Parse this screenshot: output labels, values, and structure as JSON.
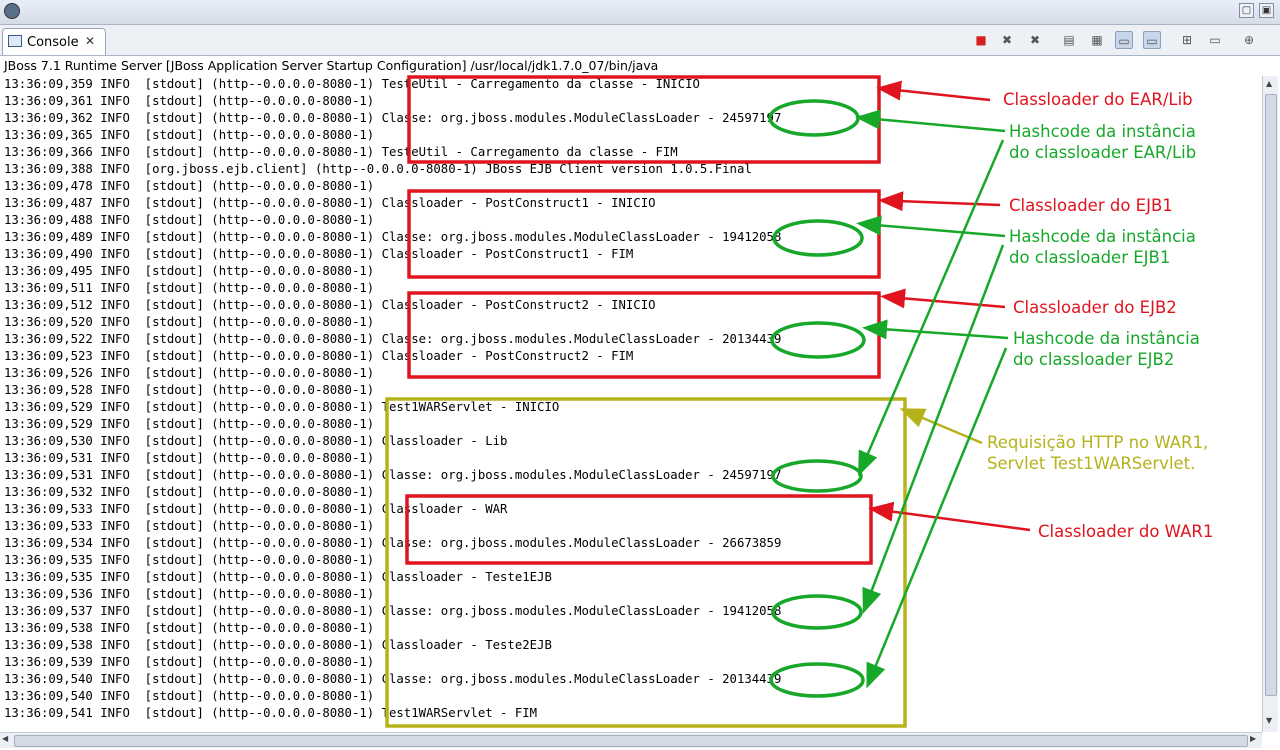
{
  "colors": {
    "red": "#e0141e",
    "green": "#17a82a",
    "olive": "#b5b21a"
  },
  "tab": {
    "label": "Console",
    "icon": "console-icon",
    "close_icon": "close-icon"
  },
  "window": {
    "minimize_icon": "minimize-icon",
    "maximize_icon": "maximize-icon"
  },
  "toolbar_icons": [
    "terminate-icon",
    "remove-launch-icon",
    "remove-all-icon",
    "clear-console-icon",
    "scroll-lock-icon",
    "show-stdout-icon",
    "show-stderr-icon",
    "pin-console-icon",
    "display-console-icon",
    "open-console-icon"
  ],
  "console": {
    "header": "JBoss 7.1 Runtime Server [JBoss Application Server Startup Configuration] /usr/local/jdk1.7.0_07/bin/java",
    "lines": [
      {
        "p": "13:36:09,359 INFO  [stdout] (http--0.0.0.0-8080-1)",
        "m": "TesteUtil - Carregamento da classe - INICIO"
      },
      {
        "p": "13:36:09,361 INFO  [stdout] (http--0.0.0.0-8080-1)",
        "m": ""
      },
      {
        "p": "13:36:09,362 INFO  [stdout] (http--0.0.0.0-8080-1)",
        "m": "Classe: org.jboss.modules.ModuleClassLoader - 24597197"
      },
      {
        "p": "13:36:09,365 INFO  [stdout] (http--0.0.0.0-8080-1)",
        "m": ""
      },
      {
        "p": "13:36:09,366 INFO  [stdout] (http--0.0.0.0-8080-1)",
        "m": "TesteUtil - Carregamento da classe - FIM"
      },
      {
        "p": "13:36:09,388 INFO  [org.jboss.ejb.client] (http--0.0.0.0-8080-1)",
        "m": "JBoss EJB Client version 1.0.5.Final"
      },
      {
        "p": "13:36:09,478 INFO  [stdout] (http--0.0.0.0-8080-1)",
        "m": ""
      },
      {
        "p": "13:36:09,487 INFO  [stdout] (http--0.0.0.0-8080-1)",
        "m": "Classloader - PostConstruct1 - INICIO"
      },
      {
        "p": "13:36:09,488 INFO  [stdout] (http--0.0.0.0-8080-1)",
        "m": ""
      },
      {
        "p": "13:36:09,489 INFO  [stdout] (http--0.0.0.0-8080-1)",
        "m": "Classe: org.jboss.modules.ModuleClassLoader - 19412058"
      },
      {
        "p": "13:36:09,490 INFO  [stdout] (http--0.0.0.0-8080-1)",
        "m": "Classloader - PostConstruct1 - FIM"
      },
      {
        "p": "13:36:09,495 INFO  [stdout] (http--0.0.0.0-8080-1)",
        "m": ""
      },
      {
        "p": "13:36:09,511 INFO  [stdout] (http--0.0.0.0-8080-1)",
        "m": ""
      },
      {
        "p": "13:36:09,512 INFO  [stdout] (http--0.0.0.0-8080-1)",
        "m": "Classloader - PostConstruct2 - INICIO"
      },
      {
        "p": "13:36:09,520 INFO  [stdout] (http--0.0.0.0-8080-1)",
        "m": ""
      },
      {
        "p": "13:36:09,522 INFO  [stdout] (http--0.0.0.0-8080-1)",
        "m": "Classe: org.jboss.modules.ModuleClassLoader - 20134439"
      },
      {
        "p": "13:36:09,523 INFO  [stdout] (http--0.0.0.0-8080-1)",
        "m": "Classloader - PostConstruct2 - FIM"
      },
      {
        "p": "13:36:09,526 INFO  [stdout] (http--0.0.0.0-8080-1)",
        "m": ""
      },
      {
        "p": "13:36:09,528 INFO  [stdout] (http--0.0.0.0-8080-1)",
        "m": ""
      },
      {
        "p": "13:36:09,529 INFO  [stdout] (http--0.0.0.0-8080-1)",
        "m": "Test1WARServlet - INICIO"
      },
      {
        "p": "13:36:09,529 INFO  [stdout] (http--0.0.0.0-8080-1)",
        "m": ""
      },
      {
        "p": "13:36:09,530 INFO  [stdout] (http--0.0.0.0-8080-1)",
        "m": "Classloader - Lib"
      },
      {
        "p": "13:36:09,531 INFO  [stdout] (http--0.0.0.0-8080-1)",
        "m": ""
      },
      {
        "p": "13:36:09,531 INFO  [stdout] (http--0.0.0.0-8080-1)",
        "m": "Classe: org.jboss.modules.ModuleClassLoader - 24597197"
      },
      {
        "p": "13:36:09,532 INFO  [stdout] (http--0.0.0.0-8080-1)",
        "m": ""
      },
      {
        "p": "13:36:09,533 INFO  [stdout] (http--0.0.0.0-8080-1)",
        "m": "Classloader - WAR"
      },
      {
        "p": "13:36:09,533 INFO  [stdout] (http--0.0.0.0-8080-1)",
        "m": ""
      },
      {
        "p": "13:36:09,534 INFO  [stdout] (http--0.0.0.0-8080-1)",
        "m": "Classe: org.jboss.modules.ModuleClassLoader - 26673859"
      },
      {
        "p": "13:36:09,535 INFO  [stdout] (http--0.0.0.0-8080-1)",
        "m": ""
      },
      {
        "p": "13:36:09,535 INFO  [stdout] (http--0.0.0.0-8080-1)",
        "m": "Classloader - Teste1EJB"
      },
      {
        "p": "13:36:09,536 INFO  [stdout] (http--0.0.0.0-8080-1)",
        "m": ""
      },
      {
        "p": "13:36:09,537 INFO  [stdout] (http--0.0.0.0-8080-1)",
        "m": "Classe: org.jboss.modules.ModuleClassLoader - 19412058"
      },
      {
        "p": "13:36:09,538 INFO  [stdout] (http--0.0.0.0-8080-1)",
        "m": ""
      },
      {
        "p": "13:36:09,538 INFO  [stdout] (http--0.0.0.0-8080-1)",
        "m": "Classloader - Teste2EJB"
      },
      {
        "p": "13:36:09,539 INFO  [stdout] (http--0.0.0.0-8080-1)",
        "m": ""
      },
      {
        "p": "13:36:09,540 INFO  [stdout] (http--0.0.0.0-8080-1)",
        "m": "Classe: org.jboss.modules.ModuleClassLoader - 20134439"
      },
      {
        "p": "13:36:09,540 INFO  [stdout] (http--0.0.0.0-8080-1)",
        "m": ""
      },
      {
        "p": "13:36:09,541 INFO  [stdout] (http--0.0.0.0-8080-1)",
        "m": "Test1WARServlet - FIM"
      }
    ]
  },
  "annotations": {
    "ear_lib": "Classloader do EAR/Lib",
    "hash_ear_1": "Hashcode da instância",
    "hash_ear_2": "do classloader EAR/Lib",
    "ejb1": "Classloader do EJB1",
    "hash_ejb1_1": "Hashcode da instância",
    "hash_ejb1_2": "do classloader EJB1",
    "ejb2": "Classloader do EJB2",
    "hash_ejb2_1": "Hashcode da instância",
    "hash_ejb2_2": "do classloader EJB2",
    "http_1": "Requisição HTTP no WAR1,",
    "http_2": "Servlet Test1WARServlet.",
    "war1": "Classloader do WAR1"
  },
  "hashcodes": [
    "24597197",
    "19412058",
    "20134439",
    "24597197",
    "19412058",
    "20134439"
  ]
}
